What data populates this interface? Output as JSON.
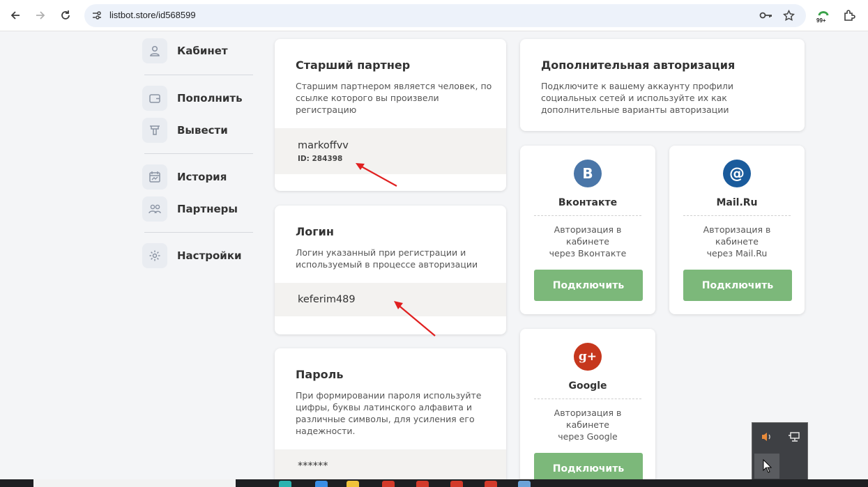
{
  "browser": {
    "url": "listbot.store/id568599",
    "extension_badge": "99+"
  },
  "sidebar": {
    "items": [
      {
        "label": "Кабинет",
        "icon": "user-icon"
      },
      {
        "label": "Пополнить",
        "icon": "wallet-icon"
      },
      {
        "label": "Вывести",
        "icon": "withdraw-icon"
      },
      {
        "label": "История",
        "icon": "calendar-chart-icon"
      },
      {
        "label": "Партнеры",
        "icon": "partners-icon"
      },
      {
        "label": "Настройки",
        "icon": "gear-icon"
      }
    ]
  },
  "senior_partner": {
    "title": "Старший партнер",
    "description": "Старшим партнером является человек, по ссылке которого вы произвели регистрацию",
    "name": "markoffvv",
    "id_text": "ID: 284398"
  },
  "login": {
    "title": "Логин",
    "description": "Логин указанный при регистрации и используемый в процессе авторизации",
    "value": "keferim489"
  },
  "password": {
    "title": "Пароль",
    "description": "При формировании пароля используйте цифры, буквы латинского алфавита и различные символы, для усиления его надежности.",
    "value": "******"
  },
  "extra_auth": {
    "title": "Дополнительная авторизация",
    "description": "Подключите к вашему аккаунту профили социальных сетей и используйте их как дополнительные варианты авторизации"
  },
  "social": [
    {
      "name": "Вконтакте",
      "line1": "Авторизация в",
      "line2": "кабинете",
      "line3": "через Вконтакте",
      "button": "Подключить",
      "logo_text": "B",
      "color": "#4a76a8"
    },
    {
      "name": "Mail.Ru",
      "line1": "Авторизация в",
      "line2": "кабинете",
      "line3": "через Mail.Ru",
      "button": "Подключить",
      "logo_text": "@",
      "color": "#1a5b9c"
    },
    {
      "name": "Google",
      "line1": "Авторизация в",
      "line2": "кабинете",
      "line3": "через Google",
      "button": "Подключить",
      "logo_text": "g+",
      "color": "#c6371d"
    }
  ],
  "colors": {
    "accent_green": "#7cb87a",
    "band_border": "#8bc48a",
    "annotation_arrow": "#e02020"
  }
}
